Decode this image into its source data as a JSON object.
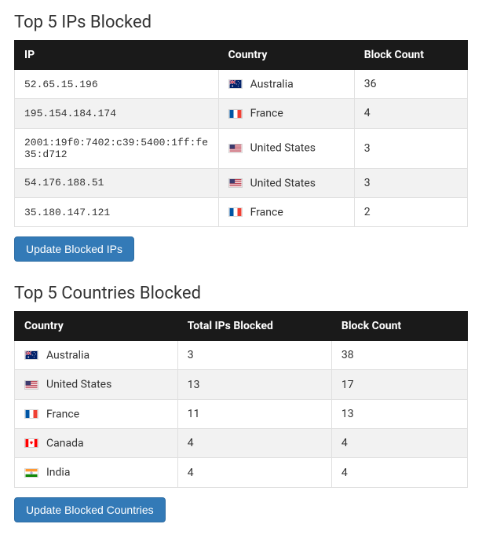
{
  "ips_section": {
    "title": "Top 5 IPs Blocked",
    "headers": {
      "ip": "IP",
      "country": "Country",
      "count": "Block Count"
    },
    "rows": [
      {
        "ip": "52.65.15.196",
        "country": "Australia",
        "flag": "au",
        "count": "36"
      },
      {
        "ip": "195.154.184.174",
        "country": "France",
        "flag": "fr",
        "count": "4"
      },
      {
        "ip": "2001:19f0:7402:c39:5400:1ff:fe35:d712",
        "country": "United States",
        "flag": "us",
        "count": "3"
      },
      {
        "ip": "54.176.188.51",
        "country": "United States",
        "flag": "us",
        "count": "3"
      },
      {
        "ip": "35.180.147.121",
        "country": "France",
        "flag": "fr",
        "count": "2"
      }
    ],
    "button": "Update Blocked IPs"
  },
  "countries_section": {
    "title": "Top 5 Countries Blocked",
    "headers": {
      "country": "Country",
      "total": "Total IPs Blocked",
      "count": "Block Count"
    },
    "rows": [
      {
        "country": "Australia",
        "flag": "au",
        "total": "3",
        "count": "38"
      },
      {
        "country": "United States",
        "flag": "us",
        "total": "13",
        "count": "17"
      },
      {
        "country": "France",
        "flag": "fr",
        "total": "11",
        "count": "13"
      },
      {
        "country": "Canada",
        "flag": "ca",
        "total": "4",
        "count": "4"
      },
      {
        "country": "India",
        "flag": "in",
        "total": "4",
        "count": "4"
      }
    ],
    "button": "Update Blocked Countries"
  }
}
